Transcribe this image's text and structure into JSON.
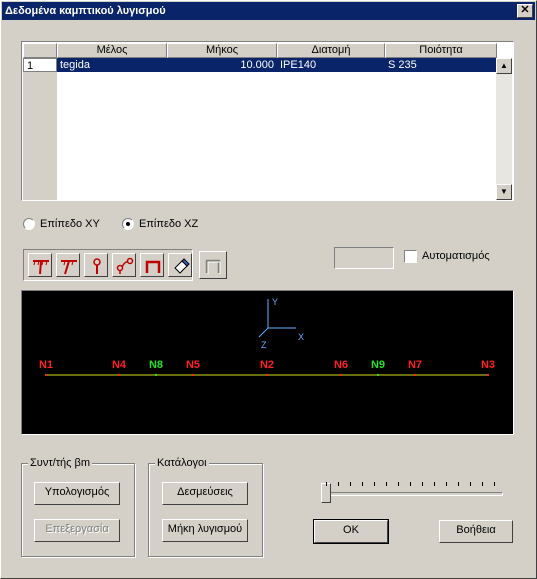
{
  "window": {
    "title": "Δεδομένα καμπτικού λυγισμού",
    "close_label": "✕"
  },
  "table": {
    "columns": [
      "Μέλος",
      "Μήκος",
      "Διατομή",
      "Ποιότητα"
    ],
    "rows": [
      {
        "num": "1",
        "member": "tegida",
        "length": "10.000",
        "section": "IPE140",
        "quality": "S 235"
      }
    ]
  },
  "plane": {
    "xy_label": "Επίπεδο XY",
    "xz_label": "Επίπεδο XZ",
    "selected": "xz"
  },
  "auto": {
    "label": "Αυτοματισμός",
    "checked": false,
    "value": ""
  },
  "canvas": {
    "axes": {
      "x": "X",
      "y": "Y",
      "z": "Z"
    },
    "nodes": [
      {
        "label": "N1",
        "color": "#ff2020"
      },
      {
        "label": "N4",
        "color": "#ff2020"
      },
      {
        "label": "N8",
        "color": "#20e020"
      },
      {
        "label": "N5",
        "color": "#ff2020"
      },
      {
        "label": "N2",
        "color": "#ff2020"
      },
      {
        "label": "N6",
        "color": "#ff2020"
      },
      {
        "label": "N9",
        "color": "#20e020"
      },
      {
        "label": "N7",
        "color": "#ff2020"
      },
      {
        "label": "N3",
        "color": "#ff2020"
      }
    ],
    "beam_color": "#d8d820",
    "axis_color": "#5fb0ff"
  },
  "bm_group": {
    "title": "Συντ/τής βm",
    "calc_label": "Υπολογισμός",
    "edit_label": "Επεξεργασία"
  },
  "catalog_group": {
    "title": "Κατάλογοι",
    "constraints_label": "Δεσμεύσεις",
    "lengths_label": "Μήκη λυγισμού"
  },
  "buttons": {
    "ok_label": "OK",
    "help_label": "Βοήθεια"
  },
  "slider": {
    "value": 0
  }
}
